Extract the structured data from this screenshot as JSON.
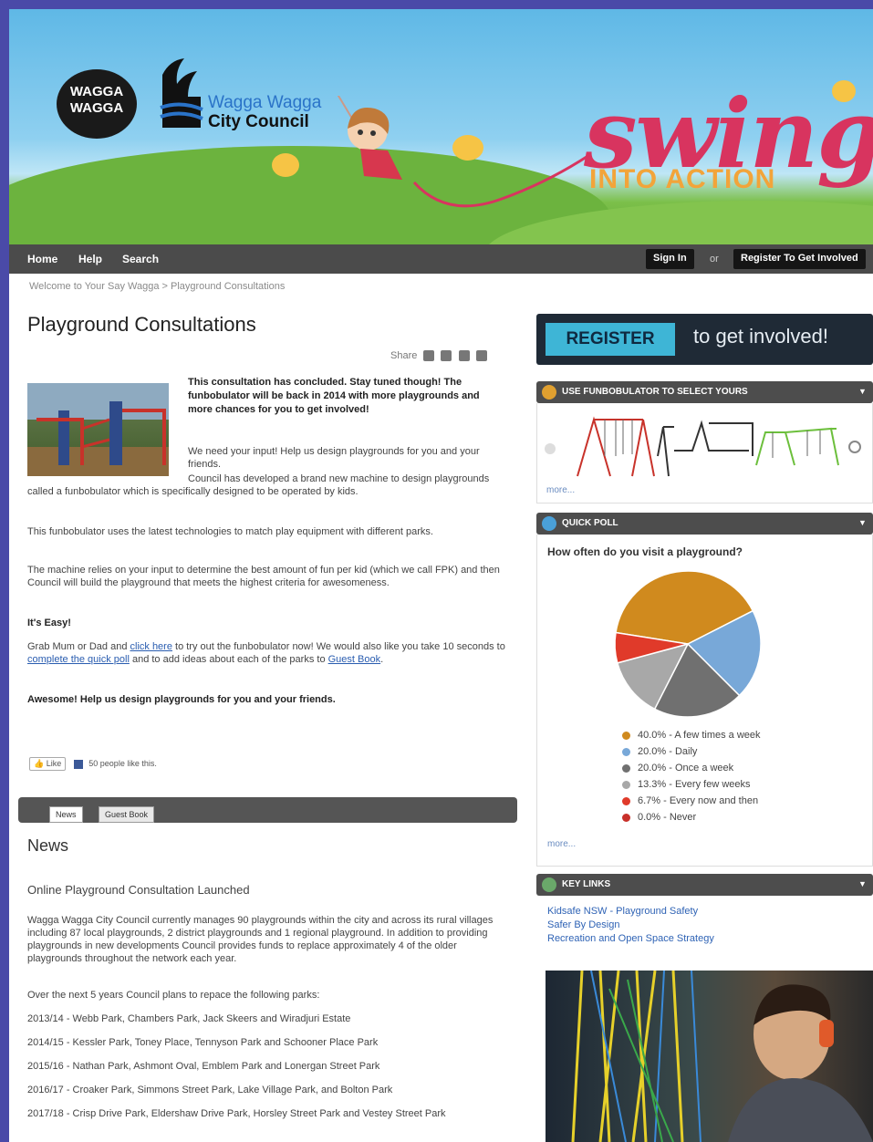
{
  "header": {
    "logo_text": "WAGGA WAGGA",
    "council_line1": "Wagga Wagga",
    "council_line2": "City Council",
    "banner_word": "swing",
    "banner_sub": "INTO ACTION"
  },
  "nav": {
    "home": "Home",
    "help": "Help",
    "search": "Search",
    "sign_in": "Sign In",
    "or": "or",
    "register": "Register To Get Involved"
  },
  "breadcrumb": "Welcome to Your Say Wagga  >  Playground Consultations",
  "main": {
    "title": "Playground Consultations",
    "share_label": "Share",
    "concluded_notice": "This consultation has concluded. Stay tuned though! The funbobulator will be back in 2014 with more playgrounds and more chances for you to get involved!",
    "p1a": "We need your input! Help us design playgrounds for you and your friends.",
    "p1b": "Council has developed a brand new machine to design playgrounds called a funbobulator which is specifically designed to be operated by kids.",
    "p2": "This funbobulator uses the latest technologies to match play equipment with different parks.",
    "p3": "The machine relies on your input to determine the best amount of fun per kid (which we call FPK) and then Council will build the playground that meets the highest criteria for awesomeness.",
    "easy_heading": "It's Easy!",
    "p4_a": "Grab Mum or Dad and ",
    "p4_link1": "click here",
    "p4_b": " to try out the funbobulator now! We would also like you take 10 seconds to ",
    "p4_link2": "complete the quick poll",
    "p4_c": " and to add ideas about each of the parks to ",
    "p4_link3": "Guest Book",
    "p4_d": ".",
    "p5": "Awesome! Help us design playgrounds for you and your friends.",
    "like_button": "Like",
    "like_count": "50 people like this."
  },
  "tabs": {
    "news": "News",
    "guestbook": "Guest Book"
  },
  "news": {
    "heading": "News",
    "subheading": "Online Playground Consultation Launched",
    "p1": "Wagga Wagga City Council currently manages 90 playgrounds within the city and across its rural villages including 87 local playgrounds, 2 district playgrounds and 1 regional playground. In addition to providing playgrounds in new developments Council provides funds to replace approximately 4 of the older playgrounds throughout the network each year.",
    "p2": "Over the next 5 years Council plans to repace the following parks:",
    "items": [
      "2013/14 - Webb Park, Chambers Park, Jack Skeers and Wiradjuri Estate",
      "2014/15 - Kessler Park, Toney Place, Tennyson Park and Schooner Place Park",
      "2015/16 - Nathan Park, Ashmont Oval, Emblem Park and Lonergan Street Park",
      "2016/17 - Croaker Park, Simmons Street Park, Lake Village Park, and Bolton Park",
      "2017/18 - Crisp Drive Park, Eldershaw Drive Park, Horsley Street Park and Vestey Street Park"
    ]
  },
  "sidebar": {
    "register_btn": "REGISTER",
    "register_text": "to get involved!",
    "funbobulator_title": "USE FUNBOBULATOR TO SELECT YOURS",
    "more1": "more...",
    "poll_title": "QUICK POLL",
    "poll_question": "How often do you visit a playground?",
    "poll_legend": [
      {
        "label": "40.0% - A few times a week",
        "color": "#d08a1e"
      },
      {
        "label": "20.0% - Daily",
        "color": "#78a8d8"
      },
      {
        "label": "20.0% - Once a week",
        "color": "#707070"
      },
      {
        "label": "13.3% - Every few weeks",
        "color": "#a8a8a8"
      },
      {
        "label": "6.7% - Every now and then",
        "color": "#e03a2a"
      },
      {
        "label": "0.0% - Never",
        "color": "#c8302a"
      }
    ],
    "more2": "more...",
    "keylinks_title": "KEY LINKS",
    "keylinks": [
      "Kidsafe NSW - Playground Safety",
      "Safer By Design",
      "Recreation and Open Space Strategy"
    ]
  },
  "chart_data": {
    "type": "pie",
    "title": "How often do you visit a playground?",
    "categories": [
      "A few times a week",
      "Daily",
      "Once a week",
      "Every few weeks",
      "Every now and then",
      "Never"
    ],
    "values": [
      40.0,
      20.0,
      20.0,
      13.3,
      6.7,
      0.0
    ],
    "colors": [
      "#d08a1e",
      "#78a8d8",
      "#707070",
      "#a8a8a8",
      "#e03a2a",
      "#c8302a"
    ]
  }
}
